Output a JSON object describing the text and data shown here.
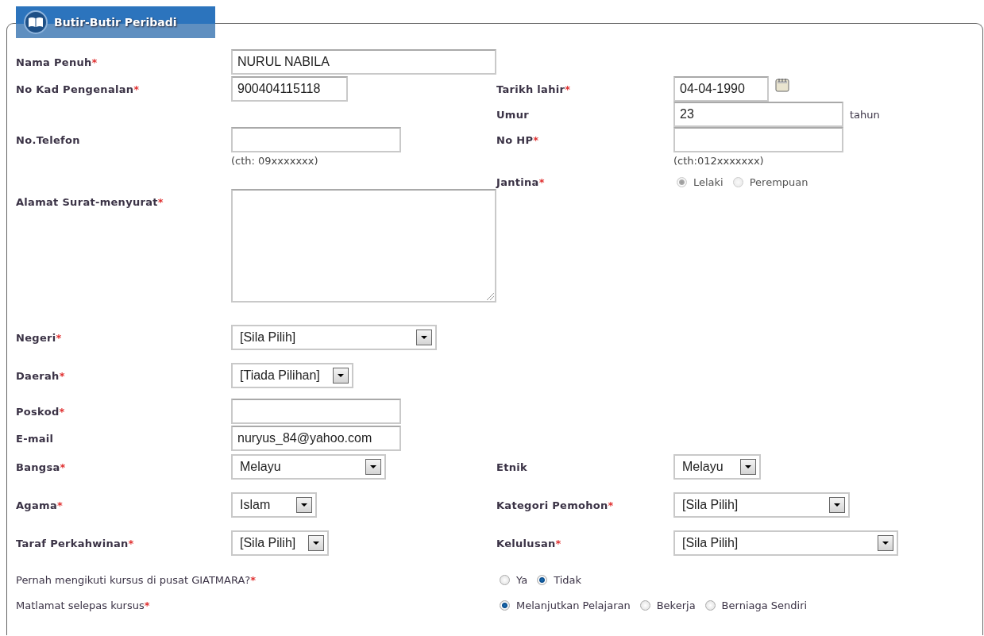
{
  "section": {
    "title": "Butir-Butir Peribadi"
  },
  "rows": [
    {
      "kind": "field",
      "left": {
        "label": "Nama Penuh",
        "mark": "*",
        "field": {
          "kind": "text",
          "value": "NURUL NABILA"
        }
      }
    },
    {
      "kind": "field",
      "left": {
        "label": "No Kad Pengenalan",
        "mark": "*",
        "field": {
          "kind": "text",
          "value": "900404115118"
        }
      },
      "right": {
        "label": "Tarikh lahir",
        "mark": "*",
        "field": {
          "kind": "date",
          "value": "04-04-1990"
        }
      }
    },
    {
      "kind": "field",
      "right": {
        "label": "Umur",
        "field": {
          "kind": "text",
          "value": "23",
          "suffix": "tahun"
        }
      }
    },
    {
      "kind": "field",
      "left": {
        "label": "No.Telefon",
        "field": {
          "kind": "text",
          "hint": "(cth: 09xxxxxxx)"
        }
      },
      "right": {
        "label": "No HP",
        "mark": "*",
        "field": {
          "kind": "text",
          "hint": "(cth:012xxxxxxx)"
        }
      }
    },
    {
      "kind": "field",
      "right": {
        "label": "Jantina",
        "mark": "*",
        "field": {
          "kind": "radio",
          "disabled": true,
          "options": [
            {
              "label": "Lelaki",
              "selected": true
            },
            {
              "label": "Perempuan",
              "selected": false
            }
          ]
        }
      }
    },
    {
      "kind": "field",
      "left": {
        "label": "Alamat Surat-menyurat",
        "mark": "*",
        "field": {
          "kind": "textarea"
        }
      }
    },
    {
      "kind": "field",
      "left": {
        "label": "Negeri",
        "mark": "*",
        "field": {
          "kind": "select",
          "value": "[Sila Pilih]"
        }
      }
    },
    {
      "kind": "field",
      "left": {
        "label": "Daerah",
        "mark": "*",
        "field": {
          "kind": "select",
          "value": "[Tiada Pilihan]"
        }
      }
    },
    {
      "kind": "field",
      "left": {
        "label": "Poskod",
        "mark": "*",
        "field": {
          "kind": "text"
        }
      }
    },
    {
      "kind": "field",
      "left": {
        "label": "E-mail",
        "field": {
          "kind": "text",
          "value": "nuryus_84@yahoo.com"
        }
      }
    },
    {
      "kind": "field",
      "left": {
        "label": "Bangsa",
        "mark": "*",
        "field": {
          "kind": "select",
          "value": "Melayu"
        }
      },
      "right": {
        "label": "Etnik",
        "field": {
          "kind": "select",
          "value": "Melayu"
        }
      }
    },
    {
      "kind": "field",
      "left": {
        "label": "Agama",
        "mark": "*",
        "field": {
          "kind": "select",
          "value": "Islam"
        }
      },
      "right": {
        "label": "Kategori Pemohon",
        "mark": "*",
        "field": {
          "kind": "select",
          "value": "[Sila Pilih]"
        }
      }
    },
    {
      "kind": "field",
      "left": {
        "label": "Taraf Perkahwinan",
        "mark": "*",
        "field": {
          "kind": "select",
          "value": "[Sila Pilih]"
        }
      },
      "right": {
        "label": "Kelulusan",
        "mark": "*",
        "field": {
          "kind": "select",
          "value": "[Sila Pilih]"
        }
      }
    },
    {
      "kind": "question",
      "left": {
        "label": "Pernah mengikuti kursus di pusat GIATMARA?",
        "mark": "*"
      },
      "right": {
        "field": {
          "kind": "radio",
          "disabled": false,
          "options": [
            {
              "label": "Ya",
              "selected": false
            },
            {
              "label": "Tidak",
              "selected": true
            }
          ]
        }
      }
    },
    {
      "kind": "question",
      "left": {
        "label": "Matlamat selepas kursus",
        "mark": "*"
      },
      "right": {
        "field": {
          "kind": "radio",
          "disabled": false,
          "options": [
            {
              "label": "Melanjutkan Pelajaran",
              "selected": true
            },
            {
              "label": "Bekerja",
              "selected": false
            },
            {
              "label": "Berniaga Sendiri",
              "selected": false
            }
          ]
        }
      }
    }
  ]
}
